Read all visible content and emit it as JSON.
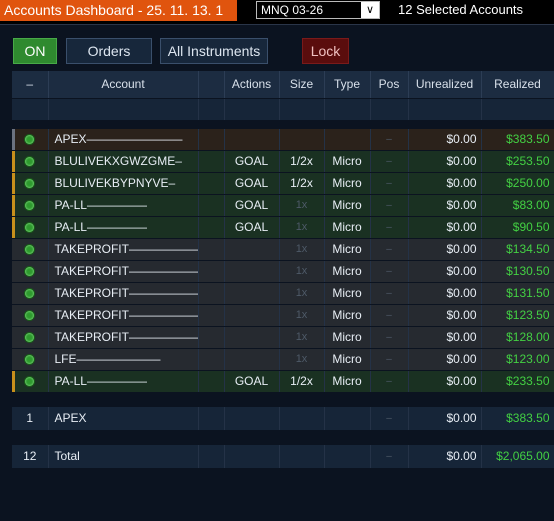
{
  "window": {
    "title": "Accounts Dashboard - 25. 11. 13. 1",
    "symbol": "MNQ 03-26",
    "selected": "12 Selected Accounts"
  },
  "toolbar": {
    "on_label": "ON",
    "orders_label": "Orders",
    "instruments_label": "All Instruments",
    "lock_label": "Lock"
  },
  "columns": {
    "dash": "–",
    "account": "Account",
    "actions": "Actions",
    "size": "Size",
    "type": "Type",
    "pos": "Pos",
    "unrealized": "Unrealized",
    "realized": "Realized"
  },
  "rows": [
    {
      "account": "APEX————————",
      "actions": "",
      "size": "",
      "type": "",
      "pos": "–",
      "unrealized": "$0.00",
      "realized": "$383.50"
    },
    {
      "account": "BLULIVEKXGWZGME–",
      "actions": "GOAL",
      "size": "1/2x",
      "type": "Micro",
      "pos": "–",
      "unrealized": "$0.00",
      "realized": "$253.50"
    },
    {
      "account": "BLULIVEKBYPNYVE–",
      "actions": "GOAL",
      "size": "1/2x",
      "type": "Micro",
      "pos": "–",
      "unrealized": "$0.00",
      "realized": "$250.00"
    },
    {
      "account": "PA-LL—————",
      "actions": "GOAL",
      "size": "1x",
      "type": "Micro",
      "pos": "–",
      "unrealized": "$0.00",
      "realized": "$83.00"
    },
    {
      "account": "PA-LL—————",
      "actions": "GOAL",
      "size": "1x",
      "type": "Micro",
      "pos": "–",
      "unrealized": "$0.00",
      "realized": "$90.50"
    },
    {
      "account": "TAKEPROFIT———————",
      "actions": "",
      "size": "1x",
      "type": "Micro",
      "pos": "–",
      "unrealized": "$0.00",
      "realized": "$134.50"
    },
    {
      "account": "TAKEPROFIT———————",
      "actions": "",
      "size": "1x",
      "type": "Micro",
      "pos": "–",
      "unrealized": "$0.00",
      "realized": "$130.50"
    },
    {
      "account": "TAKEPROFIT———————",
      "actions": "",
      "size": "1x",
      "type": "Micro",
      "pos": "–",
      "unrealized": "$0.00",
      "realized": "$131.50"
    },
    {
      "account": "TAKEPROFIT———————",
      "actions": "",
      "size": "1x",
      "type": "Micro",
      "pos": "–",
      "unrealized": "$0.00",
      "realized": "$123.50"
    },
    {
      "account": "TAKEPROFIT———————",
      "actions": "",
      "size": "1x",
      "type": "Micro",
      "pos": "–",
      "unrealized": "$0.00",
      "realized": "$128.00"
    },
    {
      "account": "LFE———————",
      "actions": "",
      "size": "1x",
      "type": "Micro",
      "pos": "–",
      "unrealized": "$0.00",
      "realized": "$123.00"
    },
    {
      "account": "PA-LL—————",
      "actions": "GOAL",
      "size": "1/2x",
      "type": "Micro",
      "pos": "–",
      "unrealized": "$0.00",
      "realized": "$233.50"
    }
  ],
  "summary_apex": {
    "count": "1",
    "account": "APEX",
    "pos": "–",
    "unrealized": "$0.00",
    "realized": "$383.50"
  },
  "summary_total": {
    "count": "12",
    "account": "Total",
    "pos": "–",
    "unrealized": "$0.00",
    "realized": "$2,065.00"
  },
  "colors": {
    "title_bg": "#e0540e",
    "profit": "#43d043",
    "marker": "#c8901c",
    "status": "#2e9a2e"
  }
}
